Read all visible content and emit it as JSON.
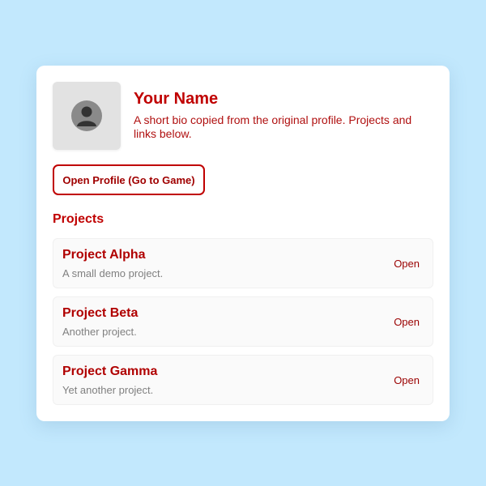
{
  "profile": {
    "name": "Your Name",
    "bio": "A short bio copied from the original profile. Projects and links below.",
    "button_label": "Open Profile (Go to Game)"
  },
  "projects_section": {
    "title": "Projects",
    "items": [
      {
        "title": "Project Alpha",
        "description": "A small demo project.",
        "action": "Open"
      },
      {
        "title": "Project Beta",
        "description": "Another project.",
        "action": "Open"
      },
      {
        "title": "Project Gamma",
        "description": "Yet another project.",
        "action": "Open"
      }
    ]
  },
  "icons": {
    "avatar": "user-silhouette-icon"
  },
  "colors": {
    "background": "#c2e8fd",
    "accent": "#c00000",
    "card": "#ffffff"
  }
}
